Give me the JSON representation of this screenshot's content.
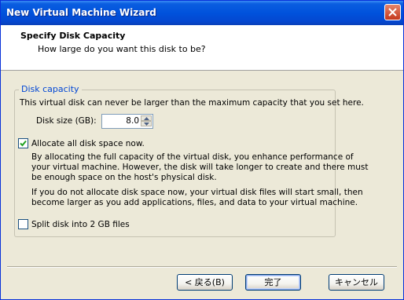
{
  "window": {
    "title": "New Virtual Machine Wizard"
  },
  "header": {
    "title": "Specify Disk Capacity",
    "subtitle": "How large do you want this disk to be?"
  },
  "disk_capacity": {
    "legend": "Disk capacity",
    "max_note": "This virtual disk can never be larger than the maximum capacity that you set here.",
    "size_label": "Disk size (GB):",
    "size_value": "8.0"
  },
  "allocate": {
    "checked": true,
    "label": "Allocate all disk space now.",
    "desc1": [
      "By allocating the full capacity of the virtual disk, you enhance performance of",
      "your virtual machine.  However, the disk will take longer to create and there must",
      "be enough space on the host's physical disk."
    ],
    "desc2": [
      "If you do not allocate disk space now, your virtual disk files will start small, then",
      "become larger as you add applications, files, and data to your virtual machine."
    ]
  },
  "split": {
    "checked": false,
    "label": "Split disk into 2 GB files"
  },
  "buttons": {
    "back": "< 戻る(B)",
    "finish": "完了",
    "cancel": "キャンセル"
  },
  "colors": {
    "titlebar": "#0052dc",
    "legend": "#0046d5",
    "face": "#ece9d8"
  }
}
